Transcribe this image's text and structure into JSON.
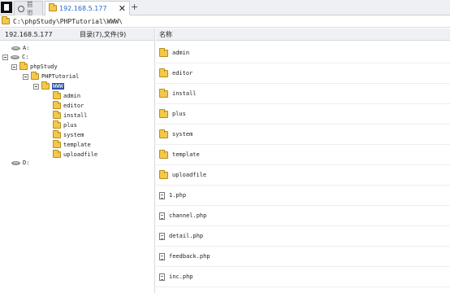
{
  "tabs": {
    "home_label": "首页",
    "remote_label": "192.168.5.177",
    "close_glyph": "✕",
    "add_glyph": "+"
  },
  "pathbar": {
    "path": "C:\\phpStudy\\PHPTutorial\\WWW\\"
  },
  "header": {
    "host": "192.168.5.177",
    "summary": "目录(7),文件(9)",
    "name_column": "名称"
  },
  "tree": {
    "drive_a": "A:",
    "drive_c": "C:",
    "phpstudy": "phpStudy",
    "phptutorial": "PHPTutorial",
    "www": "WWW",
    "children": [
      "admin",
      "editor",
      "install",
      "plus",
      "system",
      "template",
      "uploadfile"
    ],
    "drive_d": "D:"
  },
  "files": {
    "folders": [
      "admin",
      "editor",
      "install",
      "plus",
      "system",
      "template",
      "uploadfile"
    ],
    "files": [
      "1.php",
      "channel.php",
      "detail.php",
      "feedback.php",
      "inc.php"
    ]
  }
}
